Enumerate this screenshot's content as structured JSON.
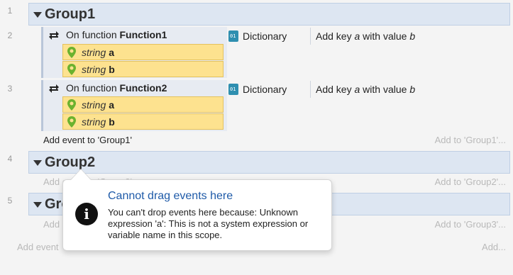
{
  "line_numbers": [
    "1",
    "2",
    "3",
    "4",
    "5"
  ],
  "groups": [
    {
      "title": "Group1",
      "add_event": "Add event to 'Group1'",
      "add_to": "Add to 'Group1'..."
    },
    {
      "title": "Group2",
      "add_event": "Add event to 'Group2'",
      "add_to": "Add to 'Group2'..."
    },
    {
      "title": "Group3",
      "add_event": "Add event to 'Group3'",
      "add_to": "Add to 'Group3'..."
    }
  ],
  "events": [
    {
      "condition_prefix": "On function ",
      "function_name": "Function1",
      "params": [
        {
          "type": "string",
          "name": "a"
        },
        {
          "type": "string",
          "name": "b"
        }
      ],
      "action_object": "Dictionary",
      "action_text_pre": "Add key ",
      "action_key": "a",
      "action_text_mid": " with value ",
      "action_value": "b"
    },
    {
      "condition_prefix": "On function ",
      "function_name": "Function2",
      "params": [
        {
          "type": "string",
          "name": "a"
        },
        {
          "type": "string",
          "name": "b"
        }
      ],
      "action_object": "Dictionary",
      "action_text_pre": "Add key ",
      "action_key": "a",
      "action_text_mid": " with value ",
      "action_value": "b"
    }
  ],
  "root": {
    "add_event": "Add event",
    "add_more": "Add..."
  },
  "tooltip": {
    "title": "Cannot drag events here",
    "body": "You can't drop events here because: Unknown expression 'a': This is not a system expression or variable name in this scope.",
    "icon": "info-icon"
  }
}
